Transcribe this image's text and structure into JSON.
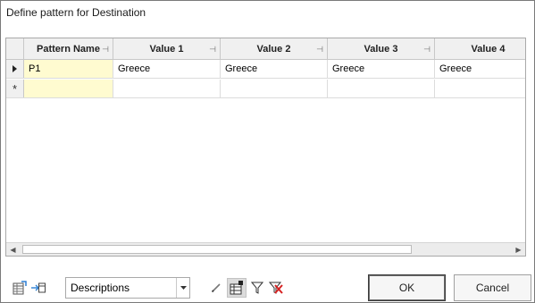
{
  "dialog": {
    "title": "Define pattern for Destination"
  },
  "grid": {
    "columns": [
      "Pattern Name",
      "Value 1",
      "Value 2",
      "Value 3",
      "Value 4"
    ],
    "rows": [
      {
        "cells": [
          "P1",
          "Greece",
          "Greece",
          "Greece",
          "Greece"
        ]
      }
    ],
    "new_row_marker": "*",
    "pin_glyph": "⊣"
  },
  "toolbar": {
    "view_select": {
      "value": "Descriptions"
    },
    "icons": [
      "table-settings-icon",
      "export-icon",
      "pencil-icon",
      "grid-layout-icon",
      "filter-icon",
      "clear-filter-icon"
    ]
  },
  "buttons": {
    "ok": "OK",
    "cancel": "Cancel"
  },
  "colors": {
    "selected_cell": "#fffbd0",
    "header_bg": "#f0f0f0",
    "ok_border": "#3c3c3c"
  }
}
